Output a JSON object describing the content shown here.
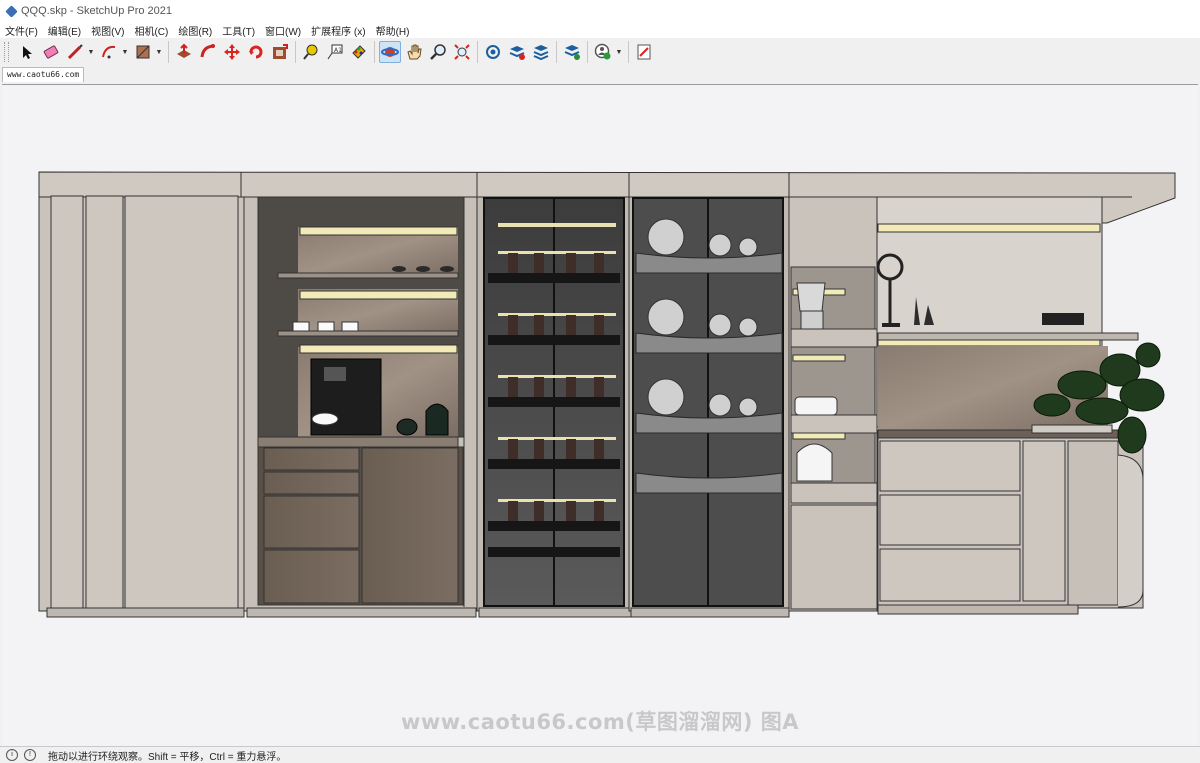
{
  "window": {
    "title": "QQQ.skp - SketchUp Pro 2021"
  },
  "menu": [
    "文件(F)",
    "编辑(E)",
    "视图(V)",
    "相机(C)",
    "绘图(R)",
    "工具(T)",
    "窗口(W)",
    "扩展程序 (x)",
    "帮助(H)"
  ],
  "toolbar": {
    "groups": [
      [
        "select-icon",
        "eraser-icon",
        "pencil-line-icon",
        "arc-icon",
        "paint-bucket-icon"
      ],
      [
        "push-pull-icon",
        "follow-me-icon",
        "move-icon",
        "rotate-icon",
        "offset-icon"
      ],
      [
        "tape-measure-icon",
        "text-icon",
        "paint-icon"
      ],
      [
        "orbit-icon",
        "pan-icon",
        "zoom-icon",
        "zoom-extents-icon"
      ],
      [
        "warehouse-icon",
        "extension-warehouse-icon",
        "layout-icon"
      ],
      [
        "sandbox-icon"
      ],
      [
        "user-account-icon"
      ],
      [
        "report-icon"
      ]
    ],
    "active": "orbit-icon"
  },
  "tab": {
    "label": "www.caotu66.com"
  },
  "viewport": {
    "background": "#f3f3f6",
    "accent_cabinet": "#c9c3bc",
    "led_color": "#f2ebb8"
  },
  "watermark": "www.caotu66.com(草图溜溜网) 图A",
  "status": {
    "hint": "拖动以进行环绕观察。Shift = 平移，Ctrl = 重力悬浮。"
  }
}
